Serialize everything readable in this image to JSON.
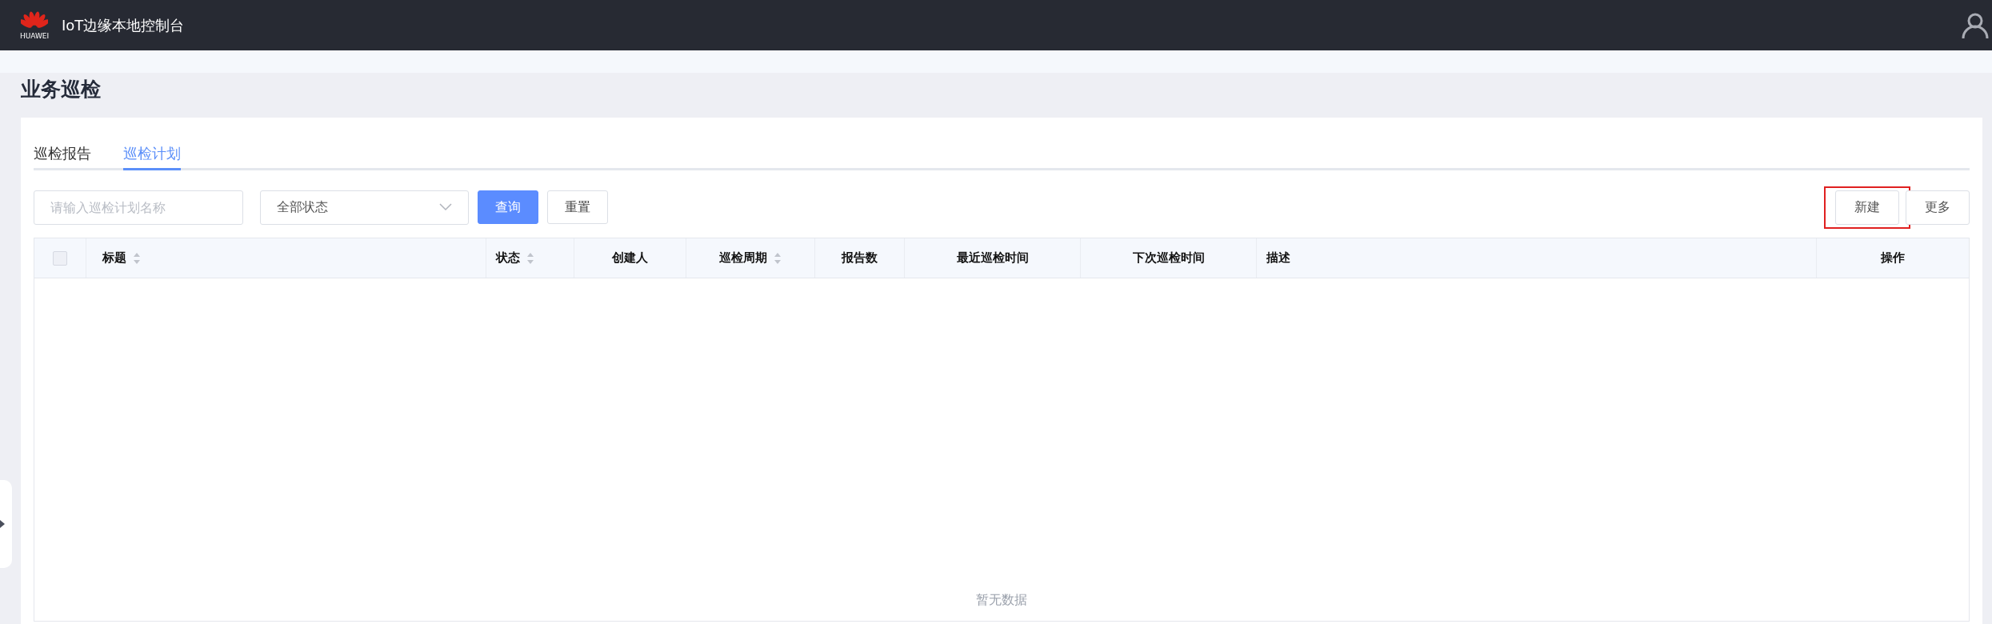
{
  "header": {
    "brand": "HUAWEI",
    "title": "IoT边缘本地控制台"
  },
  "page_title": "业务巡检",
  "tabs": [
    {
      "label": "巡检报告",
      "selected": false
    },
    {
      "label": "巡检计划",
      "selected": true
    }
  ],
  "filters": {
    "name_field": {
      "placeholder": "请输入巡检计划名称"
    },
    "status_select": {
      "value": "全部状态"
    },
    "buttons": [
      {
        "label": "查询",
        "kind": "primary"
      },
      {
        "label": "重置",
        "kind": "default"
      }
    ]
  },
  "actions": [
    {
      "label": "新建",
      "highlighted": true
    },
    {
      "label": "更多",
      "highlighted": false
    }
  ],
  "table": {
    "select_all": {
      "checked": false
    },
    "columns": [
      {
        "label": "标题",
        "sortable": true
      },
      {
        "label": "状态",
        "sortable": true
      },
      {
        "label": "创建人",
        "sortable": false
      },
      {
        "label": "巡检周期",
        "sortable": true
      },
      {
        "label": "报告数",
        "sortable": false
      },
      {
        "label": "最近巡检时间",
        "sortable": false
      },
      {
        "label": "下次巡检时间",
        "sortable": false
      },
      {
        "label": "描述",
        "sortable": false
      },
      {
        "label": "操作",
        "sortable": false
      }
    ],
    "empty_text": "暂无数据"
  }
}
